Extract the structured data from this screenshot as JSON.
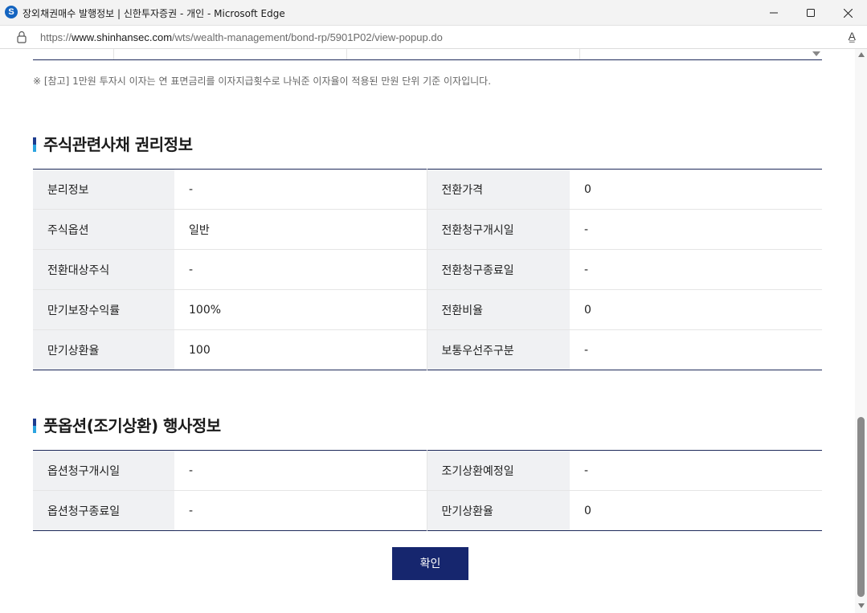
{
  "window": {
    "title": "장외채권매수 발행정보 | 신한투자증권 - 개인 - Microsoft Edge",
    "logo_letter": "S",
    "url_prefix": "https://",
    "url_host": "www.shinhansec.com",
    "url_path": "/wts/wealth-management/bond-rp/5901P02/view-popup.do",
    "read_aloud": "A͇"
  },
  "note": "※ [참고] 1만원 투자시 이자는 연 표면금리를 이자지급횟수로 나눠준 이자율이 적용된 만원 단위 기준 이자입니다.",
  "stock_rights": {
    "title": "주식관련사채 권리정보",
    "rows": [
      {
        "label1": "분리정보",
        "value1": "-",
        "label2": "전환가격",
        "value2": "0"
      },
      {
        "label1": "주식옵션",
        "value1": "일반",
        "label2": "전환청구개시일",
        "value2": "-"
      },
      {
        "label1": "전환대상주식",
        "value1": "-",
        "label2": "전환청구종료일",
        "value2": "-"
      },
      {
        "label1": "만기보장수익률",
        "value1": "100%",
        "label2": "전환비율",
        "value2": "0"
      },
      {
        "label1": "만기상환율",
        "value1": "100",
        "label2": "보통우선주구분",
        "value2": "-"
      }
    ]
  },
  "put_option": {
    "title": "풋옵션(조기상환) 행사정보",
    "rows": [
      {
        "label1": "옵션청구개시일",
        "value1": "-",
        "label2": "조기상환예정일",
        "value2": "-"
      },
      {
        "label1": "옵션청구종료일",
        "value1": "-",
        "label2": "만기상환율",
        "value2": "0"
      }
    ]
  },
  "confirm_label": "확인",
  "colors": {
    "accent_navy": "#16266e",
    "header_cell_bg": "#f0f1f3",
    "table_border": "#1e2a5a"
  }
}
